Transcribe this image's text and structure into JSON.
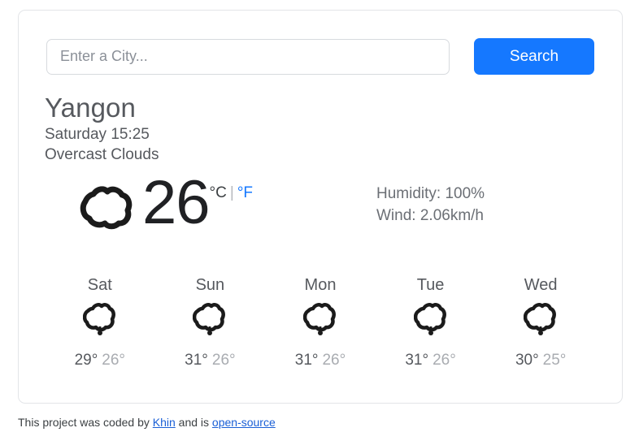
{
  "search": {
    "placeholder": "Enter a City...",
    "value": "",
    "button_label": "Search"
  },
  "current": {
    "city": "Yangon",
    "datetime": "Saturday 15:25",
    "condition": "Overcast Clouds",
    "icon": "cloud-icon",
    "temperature": "26",
    "unit_celsius": "°C",
    "unit_separator": "|",
    "unit_fahrenheit": "°F",
    "humidity": "Humidity: 100%",
    "wind": "Wind: 2.06km/h"
  },
  "forecast": [
    {
      "day": "Sat",
      "icon": "cloud-icon",
      "high": "29°",
      "low": "26°"
    },
    {
      "day": "Sun",
      "icon": "cloud-icon",
      "high": "31°",
      "low": "26°"
    },
    {
      "day": "Mon",
      "icon": "cloud-icon",
      "high": "31°",
      "low": "26°"
    },
    {
      "day": "Tue",
      "icon": "cloud-icon",
      "high": "31°",
      "low": "26°"
    },
    {
      "day": "Wed",
      "icon": "cloud-icon",
      "high": "30°",
      "low": "25°"
    }
  ],
  "footer": {
    "text_before": "This project was coded by ",
    "author_link": "Khin",
    "text_middle": " and is ",
    "source_link": "open-source"
  },
  "colors": {
    "accent": "#1578ff",
    "link": "#1a5fd6",
    "text": "#56595e",
    "muted": "#a9acb1"
  }
}
